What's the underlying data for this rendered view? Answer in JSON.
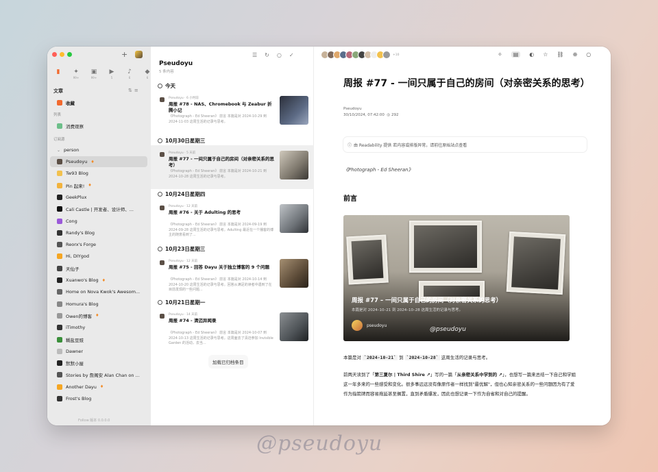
{
  "sidebar": {
    "categories": [
      {
        "icon": "article-icon",
        "count": "",
        "active": true
      },
      {
        "icon": "twitter-icon",
        "count": "99+"
      },
      {
        "icon": "image-icon",
        "count": "99+"
      },
      {
        "icon": "video-icon",
        "count": "5"
      },
      {
        "icon": "audio-icon",
        "count": "6"
      },
      {
        "icon": "notification-icon",
        "count": "6"
      }
    ],
    "section_title": "文章",
    "favorites": "收藏",
    "list_label": "列表",
    "list_item": "消费观察",
    "subscriptions_label": "订阅源",
    "folder": "person",
    "feeds": [
      {
        "name": "Pseudoyu",
        "color": "#5b4f46",
        "flame": true,
        "active": true
      },
      {
        "name": "Tw93 Blog",
        "color": "#f2c14e"
      },
      {
        "name": "Pin 起来!",
        "color": "#f2b33d",
        "flame": true
      },
      {
        "name": "GeekPlux",
        "color": "#222222"
      },
      {
        "name": "Cali Castle | 开发者、设计师、...",
        "color": "#111111"
      },
      {
        "name": "Cong",
        "color": "#9b59d9"
      },
      {
        "name": "Randy's Blog",
        "color": "#333333"
      },
      {
        "name": "Reorx's Forge",
        "color": "#555555"
      },
      {
        "name": "Hi, DIYgod",
        "color": "#f5a623"
      },
      {
        "name": "天仙子",
        "color": "#444444"
      },
      {
        "name": "Xuanwo's Blog",
        "color": "#222222",
        "flame": true
      },
      {
        "name": "Home on Nova Kwok's Awesom...",
        "color": "#666666"
      },
      {
        "name": "Homura's Blog",
        "color": "#888888"
      },
      {
        "name": "Owen的博客",
        "color": "#999999",
        "flame": true
      },
      {
        "name": "iTimothy",
        "color": "#333333"
      },
      {
        "name": "糊盐豆豉",
        "color": "#3a8f3a"
      },
      {
        "name": "Dawner",
        "color": "#bbbbbb"
      },
      {
        "name": "默默小屋",
        "color": "#222222"
      },
      {
        "name": "Stories by 詹阁安 Alan Chan on ...",
        "color": "#555555"
      },
      {
        "name": "Another Dayu",
        "color": "#f5a623",
        "flame": true
      },
      {
        "name": "Frost's Blog",
        "color": "#333333"
      }
    ],
    "footer": "Follow 版本 0.0.0.0"
  },
  "feed": {
    "title": "Pseudoyu",
    "subtitle": "5 条内容",
    "load_more": "加载已归档条目",
    "groups": [
      {
        "day": "今天",
        "entries": [
          {
            "meta": "Pseudoyu · 6 小时前",
            "title": "周报 #78 - NAS、Chromebook 与 Zeabur 折腾小记",
            "excerpt": "《Photograph - Ed Sheeran》 前言 本篇是对 2024-10-29 到 2024-11-03 这周生活的记录与思考。",
            "thumb": "thumb1"
          }
        ]
      },
      {
        "day": "10月30日星期三",
        "entries": [
          {
            "meta": "Pseudoyu · 5 天前",
            "title": "周报 #77 - 一间只属于自己的房间（对亲密关系的思考）",
            "excerpt": "《Photograph - Ed Sheeran》 前言 本篇是对 2024-10-21 到 2024-10-28 这周生活的记录与思考。",
            "thumb": "thumb2",
            "selected": true
          }
        ]
      },
      {
        "day": "10月24日星期四",
        "entries": [
          {
            "meta": "Pseudoyu · 12 天前",
            "title": "周报 #76 - 关于 Adulting 的思考",
            "excerpt": "《Photograph - Ed Sheeran》 前言 本篇是对 2024-09-19 到 2024-09-28 这周生活的记录与思考。Adulting 最近在一个播客的博主的随意看到了...",
            "thumb": "thumb3"
          }
        ]
      },
      {
        "day": "10月23日星期三",
        "entries": [
          {
            "meta": "Pseudoyu · 12 天前",
            "title": "周报 #75 - 回答 Dayu 关于独立博客的 9 个问题",
            "excerpt": "《Photograph - Ed Sheeran》 前言 本篇是对 2024-10-14 到 2024-10-20 这周生活的记录与思考。回答从满足的读者中遇到了在目前发现的一些问题...",
            "thumb": "thumb4"
          }
        ]
      },
      {
        "day": "10月21日星期一",
        "entries": [
          {
            "meta": "Pseudoyu · 14 天前",
            "title": "周报 #74 - 清迈异闻录",
            "excerpt": "《Photograph - Ed Sheeran》 前言 本篇是对 2024-10-07 到 2024-10-13 这周生活的记录与思考。这周面去了清迈参加 Invisible Garden 的活动，去当...",
            "thumb": "thumb5"
          }
        ]
      }
    ]
  },
  "article": {
    "more_avatars": "+10",
    "title": "周报 #77 - 一间只属于自己的房间（对亲密关系的思考）",
    "author": "Pseudoyu",
    "date": "30/10/2024, 07:42:00",
    "reading": "292",
    "notice": "由 Readability 提供 若内容或排版异常，请前往原始站点查看",
    "credit": "《Photograph - Ed Sheeran》",
    "intro_heading": "前言",
    "hero_title": "周报 #77 – 一间只属于自己的房间（对亲密关系的思考）",
    "hero_sub": "本篇是对 2024–10–21 到 2024–10–28 这周生活的记录与思考。",
    "hero_name": "pseudoyu",
    "hero_watermark": "@pseudoyu",
    "p1_a": "本篇是对 ",
    "p1_code1": "`2024-10-21`",
    "p1_b": " 到 ",
    "p1_code2": "`2024-10-28`",
    "p1_c": " 这周生活的记录与思考。",
    "p2_a": "前两天读到了「",
    "p2_link1": "第三夏尔 | Third Shire ↗",
    "p2_b": "」写的一篇「",
    "p2_link2": "从亲密关系中学到的 ↗",
    "p2_c": "」，也想写一篇来总结一下自己和学姐这一年多来的一些感受和变化。很多事远远没有像原作者一样找到\"最优解\"，但也心知亲密关系的一些问题因为有了爱作为指箭牌而容易拖延甚至搁置，直到矛盾爆发，因此也想记录一下作为自省和对自己的提醒。"
  },
  "page_watermark": "@pseudoyu",
  "colors": {
    "accent": "#f26a2f",
    "sidebar_bg": "#eaeaea"
  }
}
